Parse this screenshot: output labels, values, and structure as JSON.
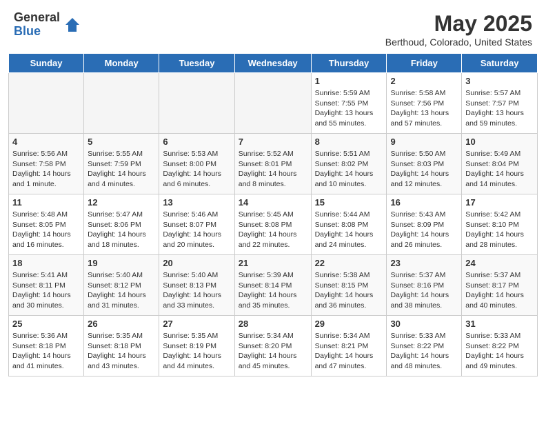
{
  "header": {
    "logo_general": "General",
    "logo_blue": "Blue",
    "month_year": "May 2025",
    "location": "Berthoud, Colorado, United States"
  },
  "days_of_week": [
    "Sunday",
    "Monday",
    "Tuesday",
    "Wednesday",
    "Thursday",
    "Friday",
    "Saturday"
  ],
  "weeks": [
    [
      {
        "num": "",
        "info": ""
      },
      {
        "num": "",
        "info": ""
      },
      {
        "num": "",
        "info": ""
      },
      {
        "num": "",
        "info": ""
      },
      {
        "num": "1",
        "info": "Sunrise: 5:59 AM\nSunset: 7:55 PM\nDaylight: 13 hours\nand 55 minutes."
      },
      {
        "num": "2",
        "info": "Sunrise: 5:58 AM\nSunset: 7:56 PM\nDaylight: 13 hours\nand 57 minutes."
      },
      {
        "num": "3",
        "info": "Sunrise: 5:57 AM\nSunset: 7:57 PM\nDaylight: 13 hours\nand 59 minutes."
      }
    ],
    [
      {
        "num": "4",
        "info": "Sunrise: 5:56 AM\nSunset: 7:58 PM\nDaylight: 14 hours\nand 1 minute."
      },
      {
        "num": "5",
        "info": "Sunrise: 5:55 AM\nSunset: 7:59 PM\nDaylight: 14 hours\nand 4 minutes."
      },
      {
        "num": "6",
        "info": "Sunrise: 5:53 AM\nSunset: 8:00 PM\nDaylight: 14 hours\nand 6 minutes."
      },
      {
        "num": "7",
        "info": "Sunrise: 5:52 AM\nSunset: 8:01 PM\nDaylight: 14 hours\nand 8 minutes."
      },
      {
        "num": "8",
        "info": "Sunrise: 5:51 AM\nSunset: 8:02 PM\nDaylight: 14 hours\nand 10 minutes."
      },
      {
        "num": "9",
        "info": "Sunrise: 5:50 AM\nSunset: 8:03 PM\nDaylight: 14 hours\nand 12 minutes."
      },
      {
        "num": "10",
        "info": "Sunrise: 5:49 AM\nSunset: 8:04 PM\nDaylight: 14 hours\nand 14 minutes."
      }
    ],
    [
      {
        "num": "11",
        "info": "Sunrise: 5:48 AM\nSunset: 8:05 PM\nDaylight: 14 hours\nand 16 minutes."
      },
      {
        "num": "12",
        "info": "Sunrise: 5:47 AM\nSunset: 8:06 PM\nDaylight: 14 hours\nand 18 minutes."
      },
      {
        "num": "13",
        "info": "Sunrise: 5:46 AM\nSunset: 8:07 PM\nDaylight: 14 hours\nand 20 minutes."
      },
      {
        "num": "14",
        "info": "Sunrise: 5:45 AM\nSunset: 8:08 PM\nDaylight: 14 hours\nand 22 minutes."
      },
      {
        "num": "15",
        "info": "Sunrise: 5:44 AM\nSunset: 8:08 PM\nDaylight: 14 hours\nand 24 minutes."
      },
      {
        "num": "16",
        "info": "Sunrise: 5:43 AM\nSunset: 8:09 PM\nDaylight: 14 hours\nand 26 minutes."
      },
      {
        "num": "17",
        "info": "Sunrise: 5:42 AM\nSunset: 8:10 PM\nDaylight: 14 hours\nand 28 minutes."
      }
    ],
    [
      {
        "num": "18",
        "info": "Sunrise: 5:41 AM\nSunset: 8:11 PM\nDaylight: 14 hours\nand 30 minutes."
      },
      {
        "num": "19",
        "info": "Sunrise: 5:40 AM\nSunset: 8:12 PM\nDaylight: 14 hours\nand 31 minutes."
      },
      {
        "num": "20",
        "info": "Sunrise: 5:40 AM\nSunset: 8:13 PM\nDaylight: 14 hours\nand 33 minutes."
      },
      {
        "num": "21",
        "info": "Sunrise: 5:39 AM\nSunset: 8:14 PM\nDaylight: 14 hours\nand 35 minutes."
      },
      {
        "num": "22",
        "info": "Sunrise: 5:38 AM\nSunset: 8:15 PM\nDaylight: 14 hours\nand 36 minutes."
      },
      {
        "num": "23",
        "info": "Sunrise: 5:37 AM\nSunset: 8:16 PM\nDaylight: 14 hours\nand 38 minutes."
      },
      {
        "num": "24",
        "info": "Sunrise: 5:37 AM\nSunset: 8:17 PM\nDaylight: 14 hours\nand 40 minutes."
      }
    ],
    [
      {
        "num": "25",
        "info": "Sunrise: 5:36 AM\nSunset: 8:18 PM\nDaylight: 14 hours\nand 41 minutes."
      },
      {
        "num": "26",
        "info": "Sunrise: 5:35 AM\nSunset: 8:18 PM\nDaylight: 14 hours\nand 43 minutes."
      },
      {
        "num": "27",
        "info": "Sunrise: 5:35 AM\nSunset: 8:19 PM\nDaylight: 14 hours\nand 44 minutes."
      },
      {
        "num": "28",
        "info": "Sunrise: 5:34 AM\nSunset: 8:20 PM\nDaylight: 14 hours\nand 45 minutes."
      },
      {
        "num": "29",
        "info": "Sunrise: 5:34 AM\nSunset: 8:21 PM\nDaylight: 14 hours\nand 47 minutes."
      },
      {
        "num": "30",
        "info": "Sunrise: 5:33 AM\nSunset: 8:22 PM\nDaylight: 14 hours\nand 48 minutes."
      },
      {
        "num": "31",
        "info": "Sunrise: 5:33 AM\nSunset: 8:22 PM\nDaylight: 14 hours\nand 49 minutes."
      }
    ]
  ]
}
